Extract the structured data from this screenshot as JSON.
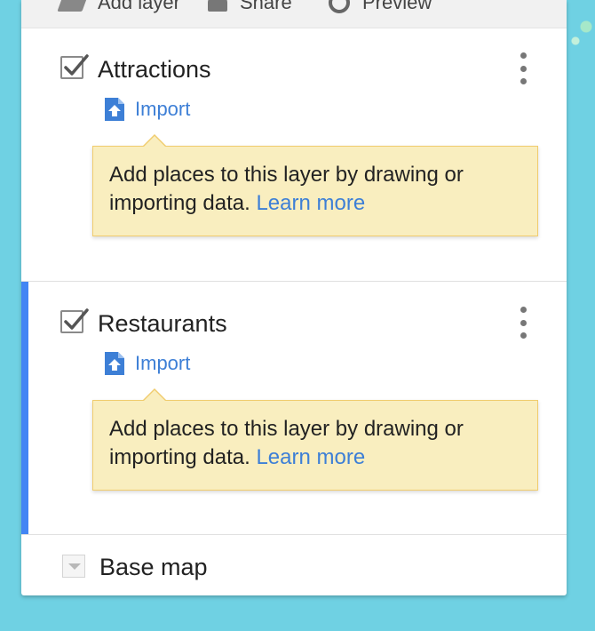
{
  "toolbar": {
    "add_layer": "Add layer",
    "share": "Share",
    "preview": "Preview"
  },
  "layers": [
    {
      "title": "Attractions",
      "checked": true,
      "import_label": "Import",
      "hint_text": "Add places to this layer by drawing or importing data.",
      "hint_link": "Learn more",
      "active": false
    },
    {
      "title": "Restaurants",
      "checked": true,
      "import_label": "Import",
      "hint_text": "Add places to this layer by drawing or importing data.",
      "hint_link": "Learn more",
      "active": true
    }
  ],
  "basemap": {
    "title": "Base map"
  },
  "colors": {
    "accent": "#4285f4",
    "link": "#3d7fd6",
    "tooltip_bg": "#f9eebf",
    "map_bg": "#6fd1e3"
  }
}
